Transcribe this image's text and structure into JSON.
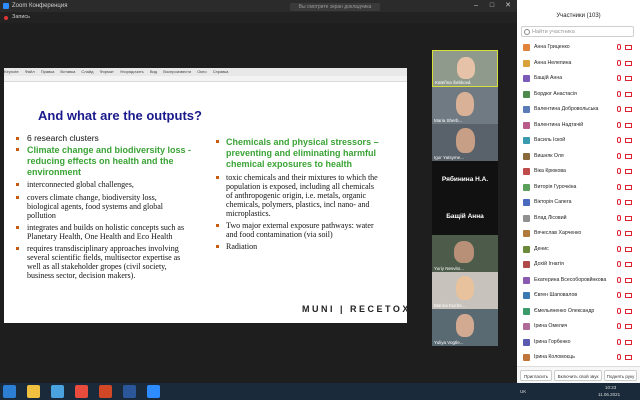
{
  "titlebar": {
    "app_title": "Zoom Конференция",
    "minimize": "–",
    "maximize": "□",
    "close": "✕",
    "share_info": "Вы смотрите экран докладчика"
  },
  "recording": {
    "label": "Запись"
  },
  "ppt_menu": [
    "Keynote",
    "Файл",
    "Правка",
    "Вставка",
    "Слайд",
    "Формат",
    "Упорядочить",
    "Вид",
    "Воспроизвести",
    "Окно",
    "Справка"
  ],
  "slide": {
    "title": "And what are the outputs?",
    "left": {
      "intro": "6 research clusters",
      "heading_l1": "Climate change and biodiversity loss -",
      "heading_l2": "reducing effects on health and the",
      "heading_l3": "environment",
      "b1": "interconnected global challenges,",
      "b2_l1": "covers climate change, biodiversity loss,",
      "b2_l2": "biological agents, food systems and global",
      "b2_l3": "pollution",
      "b3_l1": "integrates and builds on holistic concepts such as",
      "b3_l2": "Planetary Health, One Health and Eco Health",
      "b4_l1": "requires transdisciplinary approaches involving",
      "b4_l2": "several scientific fields, multisector expertise as",
      "b4_l3": "well as all stakeholder gropes (civil society,",
      "b4_l4": "business sector, decision makers)."
    },
    "right": {
      "heading_l1": "Chemicals and physical stressors  –",
      "heading_l2": "preventing and eliminating harmful",
      "heading_l3": "chemical exposures to health",
      "b1_l1": "toxic chemicals and their mixtures to which the",
      "b1_l2": "population is exposed, including all chemicals",
      "b1_l3": "of anthropogenic origin, i.e. metals, organic",
      "b1_l4": "chemicals, polymers, plastics, incl nano- and",
      "b1_l5": "microplastics.",
      "b2_l1": "Two major external exposure pathways: water",
      "b2_l2": "and food contamination (via soil)",
      "b3": "Radiation"
    },
    "brand": "MUNI | RECETOX"
  },
  "videos": [
    {
      "name": "Kateřina Šebková"
    },
    {
      "name": "Maria Sherb..."
    },
    {
      "name": "Igor Yatsyme..."
    },
    {
      "name": "Рябинина Н.А."
    },
    {
      "name": "Бащій Анна"
    },
    {
      "name": "Yuriy Nesvito..."
    },
    {
      "name": "Marina Kuche..."
    },
    {
      "name": "Yuliya Vogtle..."
    }
  ],
  "participants": {
    "header": "Участники (103)",
    "search_placeholder": "Найти участника",
    "list": [
      {
        "name": "Анна Гриценко",
        "color": "#e0823a"
      },
      {
        "name": "Анна Нелепина",
        "color": "#d9a23a"
      },
      {
        "name": "Бащій Анна",
        "color": "#7b5ab8"
      },
      {
        "name": "Бордюг Анастасія",
        "color": "#4e8a4e"
      },
      {
        "name": "Валентина Добровольськa",
        "color": "#5a7ab8"
      },
      {
        "name": "Валентина Надтачій",
        "color": "#b85a8a"
      },
      {
        "name": "Василь Іской",
        "color": "#3a9ab0"
      },
      {
        "name": "Вишняк Оля",
        "color": "#8a6a3a"
      },
      {
        "name": "Віка Крюкова",
        "color": "#c04b4b"
      },
      {
        "name": "Виторія Гурочкіна",
        "color": "#5aa05a"
      },
      {
        "name": "Вікторія Сапега",
        "color": "#4a6ac0"
      },
      {
        "name": "Влад Лісовий",
        "color": "#909090"
      },
      {
        "name": "Вячеслав Харченко",
        "color": "#b07a3a"
      },
      {
        "name": "Денис",
        "color": "#6a8a3a"
      },
      {
        "name": "Дохій Ігнатія",
        "color": "#b04a4a"
      },
      {
        "name": "Екатерина Всесоборовйнкова",
        "color": "#8a5ab0"
      },
      {
        "name": "Євген Шаповалов",
        "color": "#3a7ab0"
      },
      {
        "name": "Ємельяненко Олександр",
        "color": "#3a9a6a"
      },
      {
        "name": "Ірина Омелич",
        "color": "#b06a9a"
      },
      {
        "name": "Ірина Горбенко",
        "color": "#5a5ab0"
      },
      {
        "name": "Ірина Коломоєць",
        "color": "#c0763a"
      }
    ],
    "footer": {
      "invite": "Пригласить",
      "mute_all": "Включить свой звук",
      "raise": "Поднять руку"
    }
  },
  "taskbar": {
    "lang": "UK",
    "time": "10:23",
    "date": "11.06.2021"
  }
}
